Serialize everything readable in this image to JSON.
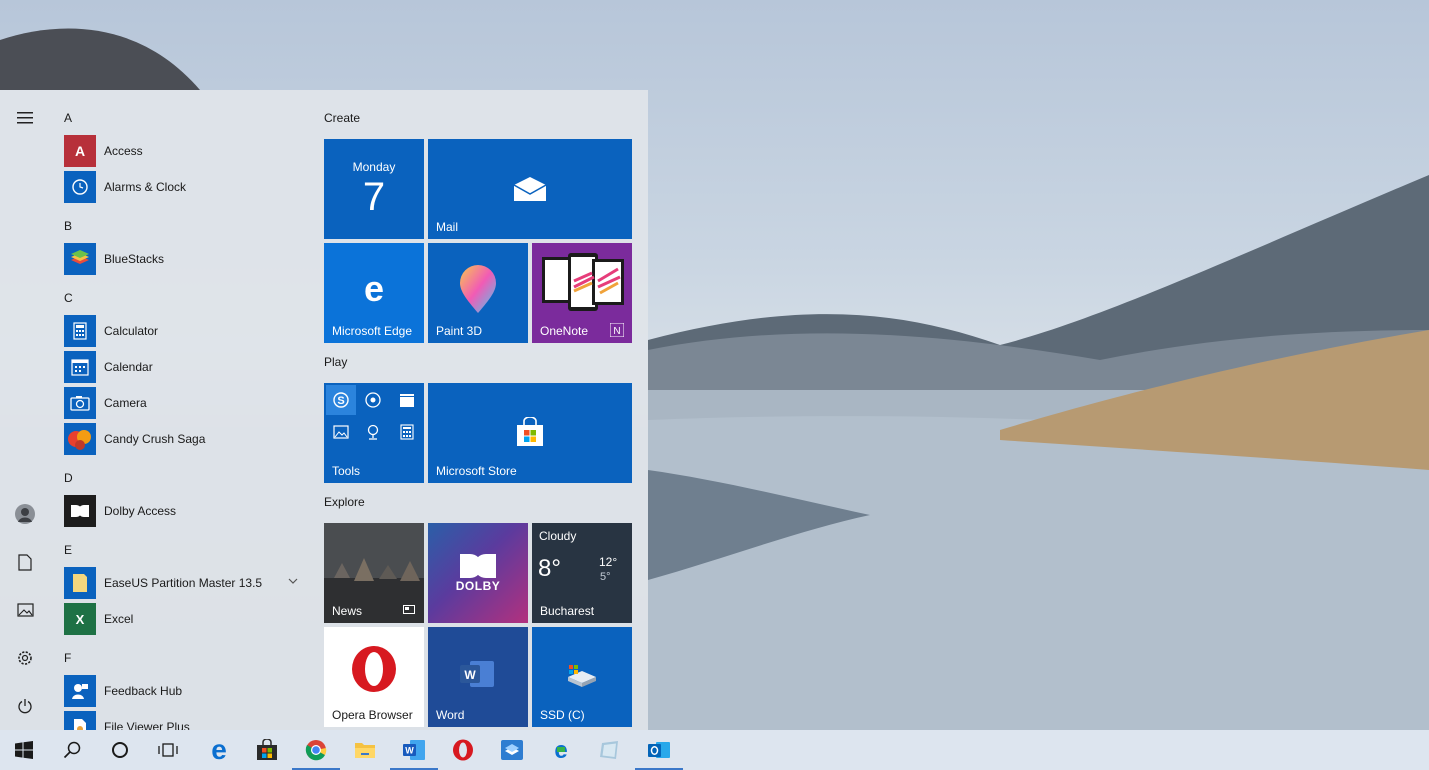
{
  "start_menu": {
    "rail": {
      "menu_icon": "hamburger-menu-icon",
      "items": [
        "user-avatar",
        "documents-icon",
        "pictures-icon",
        "settings-icon",
        "power-icon"
      ]
    },
    "app_list": {
      "groups": [
        {
          "letter": "A",
          "apps": [
            "Access",
            "Alarms & Clock"
          ]
        },
        {
          "letter": "B",
          "apps": [
            "BlueStacks"
          ]
        },
        {
          "letter": "C",
          "apps": [
            "Calculator",
            "Calendar",
            "Camera",
            "Candy Crush Saga"
          ]
        },
        {
          "letter": "D",
          "apps": [
            "Dolby Access"
          ]
        },
        {
          "letter": "E",
          "apps": [
            "EaseUS Partition Master 13.5",
            "Excel"
          ]
        },
        {
          "letter": "F",
          "apps": [
            "Feedback Hub",
            "File Viewer Plus"
          ]
        }
      ]
    },
    "tiles": {
      "groups": {
        "create": "Create",
        "play": "Play",
        "explore": "Explore"
      },
      "calendar": {
        "day": "Monday",
        "date": "7"
      },
      "mail": "Mail",
      "edge": "Microsoft Edge",
      "paint3d": "Paint 3D",
      "onenote": "OneNote",
      "tools": "Tools",
      "store": "Microsoft Store",
      "news": "News",
      "dolby": "DOLBY",
      "weather": {
        "condition": "Cloudy",
        "temp": "8°",
        "high": "12°",
        "low": "5°",
        "city": "Bucharest"
      },
      "opera": "Opera Browser",
      "word": "Word",
      "ssd": "SSD (C)"
    }
  },
  "taskbar": {
    "items": [
      "windows-start-icon",
      "search-icon",
      "cortana-icon",
      "task-view-icon",
      "edge-icon",
      "store-icon",
      "chrome-icon",
      "file-explorer-icon",
      "word-icon",
      "opera-icon",
      "stack-app-icon",
      "browser-extra-icon",
      "notes-icon",
      "outlook-icon"
    ]
  },
  "colors": {
    "tile_blue": "#0a62be",
    "taskbar": "#dde5ef",
    "start_bg": "#e0e4ea"
  }
}
